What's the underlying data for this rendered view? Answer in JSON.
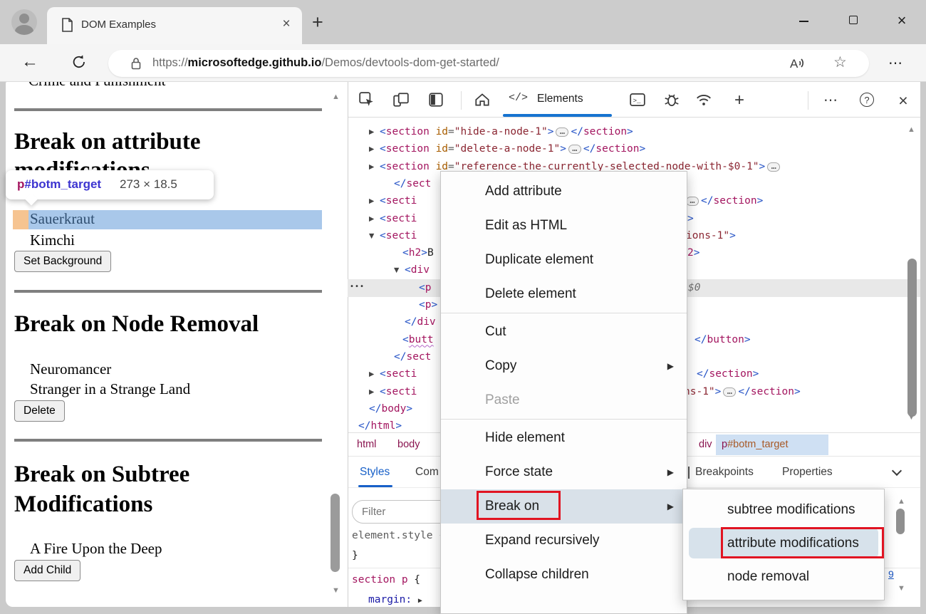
{
  "browser": {
    "tab_title": "DOM Examples",
    "url_scheme": "https://",
    "url_domain": "microsoftedge.github.io",
    "url_path": "/Demos/devtools-dom-get-started/"
  },
  "glyphs": {
    "back": "←",
    "star": "☆",
    "more": "⋯",
    "plus": "＋",
    "new_tab": "+",
    "close": "×",
    "help": "?",
    "scroll_up": "▲",
    "scroll_down": "▼",
    "menu_arrow": "▶",
    "tree_collapsed": "▶",
    "tree_expanded": "▼",
    "gutter_dots": "•••",
    "ellipsis_pill": "…",
    "elements_code": "</>"
  },
  "page": {
    "top_clipped": "Crime and Punishment",
    "heading_attr_line1": "Break on attribute",
    "heading_attr_line2": "modifications",
    "tooltip": {
      "tag": "p",
      "id": "#botm_target",
      "size": "273 × 18.5"
    },
    "item_sauerkraut": "Sauerkraut",
    "item_kimchi": "Kimchi",
    "btn_set_background": "Set Background",
    "heading_node_removal": "Break on Node Removal",
    "item_neuromancer": "Neuromancer",
    "item_stranger": "Stranger in a Strange Land",
    "btn_delete": "Delete",
    "heading_subtree_line1": "Break on Subtree",
    "heading_subtree_line2": "Modifications",
    "item_fire": "A Fire Upon the Deep",
    "btn_add_child": "Add Child"
  },
  "devtools": {
    "elements_label": "Elements",
    "breadcrumb": {
      "c1": "html",
      "c2": "body",
      "c3": "div",
      "sel_tag": "p",
      "sel_id": "#botm_target"
    },
    "tabs": {
      "styles": "Styles",
      "computed_partial": "Com",
      "breakpoints_partial": "Breakpoints",
      "properties": "Properties"
    },
    "styles_pane": {
      "filter_placeholder": "Filter",
      "inline_rule": "element.style {",
      "close_brace": "}",
      "rule_selector": "section p",
      "rule_open": " {",
      "property": "margin:",
      "line_link": "9"
    },
    "dom_lines": [
      {
        "indent": 45,
        "arrow": "r",
        "left": [
          [
            "b",
            "<"
          ],
          [
            "g",
            "section"
          ],
          [
            "t",
            " "
          ],
          [
            "a",
            "id"
          ],
          [
            "q",
            "="
          ],
          [
            "v",
            "\"hide-a-node-1\""
          ],
          [
            "b",
            ">"
          ],
          [
            "e",
            ""
          ],
          [
            "b",
            "</"
          ],
          [
            "g",
            "section"
          ],
          [
            "b",
            ">"
          ]
        ]
      },
      {
        "indent": 45,
        "arrow": "r",
        "left": [
          [
            "b",
            "<"
          ],
          [
            "g",
            "section"
          ],
          [
            "t",
            " "
          ],
          [
            "a",
            "id"
          ],
          [
            "q",
            "="
          ],
          [
            "v",
            "\"delete-a-node-1\""
          ],
          [
            "b",
            ">"
          ],
          [
            "e",
            ""
          ],
          [
            "b",
            "</"
          ],
          [
            "g",
            "section"
          ],
          [
            "b",
            ">"
          ]
        ]
      },
      {
        "indent": 45,
        "arrow": "r",
        "left": [
          [
            "b",
            "<"
          ],
          [
            "g",
            "section"
          ],
          [
            "t",
            " "
          ],
          [
            "a",
            "id"
          ],
          [
            "q",
            "="
          ],
          [
            "v",
            "\"reference-the-currently-selected-node-with-$0-1\""
          ],
          [
            "b",
            ">"
          ],
          [
            "e",
            ""
          ]
        ]
      },
      {
        "indent": 65,
        "left": [
          [
            "b",
            "</"
          ],
          [
            "g",
            "sect"
          ]
        ]
      },
      {
        "indent": 45,
        "arrow": "r",
        "left": [
          [
            "b",
            "<"
          ],
          [
            "g",
            "secti"
          ]
        ],
        "right": [
          [
            "e",
            ""
          ],
          [
            "b",
            "</"
          ],
          [
            "g",
            "section"
          ],
          [
            "b",
            ">"
          ]
        ],
        "rightX": 472
      },
      {
        "indent": 45,
        "arrow": "r",
        "left": [
          [
            "b",
            "<"
          ],
          [
            "g",
            "secti"
          ]
        ],
        "right": [
          [
            "b",
            ">"
          ]
        ],
        "rightX": 477
      },
      {
        "indent": 45,
        "arrow": "d",
        "left": [
          [
            "b",
            "<"
          ],
          [
            "g",
            "secti"
          ]
        ],
        "right": [
          [
            "v",
            "ions-1\""
          ],
          [
            "b",
            ">"
          ]
        ],
        "rightX": 475
      },
      {
        "indent": 77,
        "left": [
          [
            "b",
            "<"
          ],
          [
            "g",
            "h2"
          ],
          [
            "b",
            ">"
          ],
          [
            "t",
            "B"
          ]
        ],
        "right": [
          [
            "g",
            "2"
          ],
          [
            "b",
            ">"
          ]
        ],
        "rightX": 477
      },
      {
        "indent": 80,
        "arrow": "d",
        "left": [
          [
            "b",
            "<"
          ],
          [
            "g",
            "div"
          ]
        ]
      },
      {
        "indent": 100,
        "sel": true,
        "gutter": true,
        "left": [
          [
            "b",
            "<"
          ],
          [
            "g",
            "p"
          ]
        ],
        "right": [
          [
            "d",
            "$0"
          ]
        ],
        "rightX": 478
      },
      {
        "indent": 100,
        "left": [
          [
            "b",
            "<"
          ],
          [
            "g",
            "p"
          ],
          [
            "b",
            ">"
          ]
        ]
      },
      {
        "indent": 80,
        "left": [
          [
            "b",
            "</"
          ],
          [
            "g",
            "div"
          ]
        ]
      },
      {
        "indent": 77,
        "left": [
          [
            "b",
            "<"
          ],
          [
            "w",
            "butt"
          ]
        ],
        "right": [
          [
            "b",
            "</"
          ],
          [
            "g",
            "button"
          ],
          [
            "b",
            ">"
          ]
        ],
        "rightX": 487
      },
      {
        "indent": 65,
        "left": [
          [
            "b",
            "</"
          ],
          [
            "g",
            "sect"
          ]
        ]
      },
      {
        "indent": 45,
        "arrow": "r",
        "left": [
          [
            "b",
            "<"
          ],
          [
            "g",
            "secti"
          ]
        ],
        "right": [
          [
            "b",
            "</"
          ],
          [
            "g",
            "section"
          ],
          [
            "b",
            ">"
          ]
        ],
        "rightX": 490
      },
      {
        "indent": 45,
        "arrow": "r",
        "left": [
          [
            "b",
            "<"
          ],
          [
            "g",
            "secti"
          ]
        ],
        "right": [
          [
            "v",
            "ns-1\""
          ],
          [
            "b",
            ">"
          ],
          [
            "e",
            ""
          ],
          [
            "b",
            "</"
          ],
          [
            "g",
            "section"
          ],
          [
            "b",
            ">"
          ]
        ],
        "rightX": 472
      },
      {
        "indent": 30,
        "left": [
          [
            "b",
            "</"
          ],
          [
            "g",
            "body"
          ],
          [
            "b",
            ">"
          ]
        ]
      },
      {
        "indent": 15,
        "left": [
          [
            "b",
            "</"
          ],
          [
            "g",
            "html"
          ],
          [
            "b",
            ">"
          ]
        ]
      }
    ]
  },
  "context_menu": {
    "items": [
      {
        "label": "Add attribute"
      },
      {
        "label": "Edit as HTML"
      },
      {
        "label": "Duplicate element"
      },
      {
        "label": "Delete element",
        "sep_after": true
      },
      {
        "label": "Cut"
      },
      {
        "label": "Copy",
        "submenu": true
      },
      {
        "label": "Paste",
        "disabled": true,
        "sep_after": true
      },
      {
        "label": "Hide element"
      },
      {
        "label": "Force state",
        "submenu": true
      },
      {
        "label": "Break on",
        "submenu": true,
        "highlight": true,
        "redbox": "redbox-breakon"
      },
      {
        "label": "Expand recursively"
      },
      {
        "label": "Collapse children"
      }
    ]
  },
  "submenu": {
    "items": [
      {
        "label": "subtree modifications"
      },
      {
        "label": "attribute modifications",
        "highlight": true,
        "redbox": "redbox-attr"
      },
      {
        "label": "node removal"
      }
    ]
  }
}
